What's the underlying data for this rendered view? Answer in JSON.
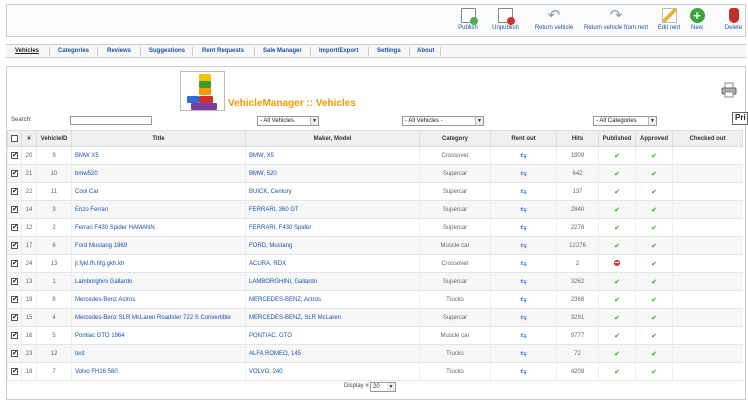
{
  "toolbar": {
    "publish": "Publish",
    "unpublish": "Unpublish",
    "return_vehicle": "Return vehicle",
    "return_vehicle_from_rent": "Return vehicle from rent",
    "edit_rent": "Edit rent",
    "new": "New",
    "delete": "Delete"
  },
  "menu": [
    "Vehicles",
    "Categories",
    "Reviews",
    "Suggestions",
    "Rent Requests",
    "Sale Manager",
    "Import/Export",
    "Settings",
    "About"
  ],
  "page_title": "VehicleManager :: Vehicles",
  "tooltip": "Pri",
  "filters": {
    "search_label": "Search:",
    "search_value": "",
    "vehicles_1": "- All Vehicles",
    "vehicles_2": "- All Vehicles -",
    "categories": "- All Categories"
  },
  "columns": [
    "#",
    "VehicleID",
    "Title",
    "Maker, Model",
    "Category",
    "Rent out",
    "Hits",
    "Published",
    "Approved",
    "Checked out"
  ],
  "rows": [
    {
      "num": "20",
      "id": "9",
      "title": "BMW X5",
      "maker": "BMW, X5",
      "category": "Crossover",
      "hits": "1809",
      "published": "yes",
      "checked": true
    },
    {
      "num": "21",
      "id": "10",
      "title": "bmw520",
      "maker": "BMW, 520",
      "category": "Supercar",
      "hits": "642",
      "published": "yes",
      "checked": true
    },
    {
      "num": "22",
      "id": "11",
      "title": "Cool Car",
      "maker": "BUICK, Century",
      "category": "Supercar",
      "hits": "137",
      "published": "yes",
      "checked": true
    },
    {
      "num": "14",
      "id": "3",
      "title": "Enzo Ferrari",
      "maker": "FERRARI, 360 GT",
      "category": "Supercar",
      "hits": "2840",
      "published": "yes",
      "checked": true
    },
    {
      "num": "12",
      "id": "2",
      "title": "Ferrari F430 Spider HAMANN",
      "maker": "FERRARI, F430 Spider",
      "category": "Supercar",
      "hits": "2278",
      "published": "yes",
      "checked": true
    },
    {
      "num": "17",
      "id": "6",
      "title": "Ford Mustang 1969",
      "maker": "FORD, Mustang",
      "category": "Muscle car",
      "hits": "12276",
      "published": "yes",
      "checked": true
    },
    {
      "num": "24",
      "id": "13",
      "title": "jl.fykl.fh.hfg.gkh.kh",
      "maker": "ACURA, RDX",
      "category": "Crossover",
      "hits": "2",
      "published": "no",
      "checked": true
    },
    {
      "num": "13",
      "id": "1",
      "title": "Lamborghini Gallardo",
      "maker": "LAMBORGHINI, Gallardo",
      "category": "Supercar",
      "hits": "3262",
      "published": "yes",
      "checked": true
    },
    {
      "num": "19",
      "id": "8",
      "title": "Mercedes-Benz Actros",
      "maker": "MERCEDES-BENZ, Actros",
      "category": "Trucks",
      "hits": "2368",
      "published": "yes",
      "checked": true
    },
    {
      "num": "15",
      "id": "4",
      "title": "Mercedes-Benz SLR McLaren Roadster 722 S Convertible",
      "maker": "MERCEDES-BENZ, SLR McLaren",
      "category": "Supercar",
      "hits": "3291",
      "published": "yes",
      "checked": true
    },
    {
      "num": "16",
      "id": "5",
      "title": "Pontiac GTO 1964",
      "maker": "PONTIAC, GTO",
      "category": "Muscle car",
      "hits": "9777",
      "published": "yes",
      "checked": true
    },
    {
      "num": "23",
      "id": "12",
      "title": "test",
      "maker": "ALFA ROMEO, 145",
      "category": "Trucks",
      "hits": "72",
      "published": "yes",
      "checked": true
    },
    {
      "num": "18",
      "id": "7",
      "title": "Volvo FH16 580",
      "maker": "VOLVO, 240",
      "category": "Trucks",
      "hits": "4209",
      "published": "yes",
      "checked": true
    }
  ],
  "footer": {
    "label": "Display #",
    "value": "20"
  },
  "icons": {
    "rent": "car-arrow-icon",
    "published": "check-icon",
    "unpublished": "red-circle-icon",
    "print": "printer-icon"
  },
  "colors": {
    "title": "#f29a00",
    "link": "#1a52a8",
    "check": "#3a9e2a"
  }
}
